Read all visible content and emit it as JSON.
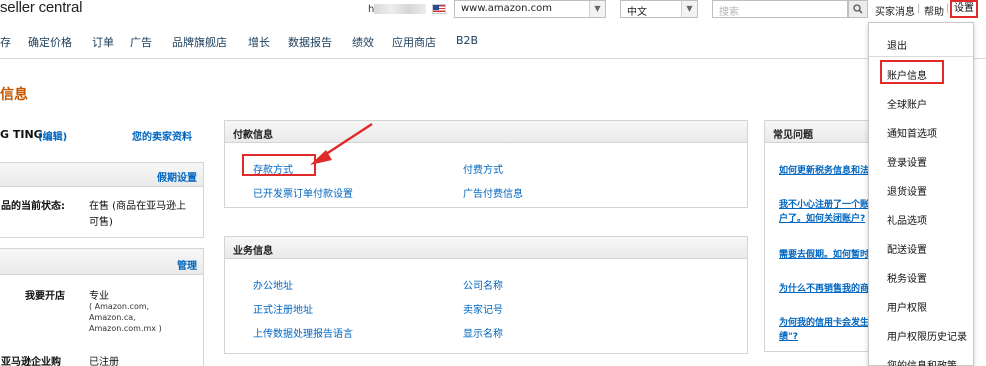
{
  "header": {
    "logo": "seller central",
    "user_initial": "h",
    "marketplace": "www.amazon.com",
    "language": "中文",
    "search_placeholder": "搜索",
    "messages": "买家消息",
    "help": "帮助",
    "settings": "设置"
  },
  "nav": [
    "存",
    "确定价格",
    "订单",
    "广告",
    "品牌旗舰店",
    "增长",
    "数据报告",
    "绩效",
    "应用商店",
    "B2B"
  ],
  "page_title": "信息",
  "left": {
    "name": "G TING",
    "edit": "(编辑)",
    "seller_profile": "您的卖家资料",
    "holiday_settings": "假期设置",
    "status_label": "品的当前状态:",
    "status_value_1": "在售 (商品在亚马逊上",
    "status_value_2": "可售)",
    "manage": "管理",
    "store_label": "我要开店",
    "store_value": "专业",
    "store_markets_1": "( Amazon.com,",
    "store_markets_2": "Amazon.ca,",
    "store_markets_3": "Amazon.com.mx )",
    "biz_label": "亚马逊企业购",
    "biz_value": "已注册"
  },
  "payment": {
    "title": "付款信息",
    "deposit_methods": "存款方式",
    "charge_methods": "付费方式",
    "invoice_settings": "已开发票订单付款设置",
    "ad_payment": "广告付费信息"
  },
  "business": {
    "title": "业务信息",
    "office_address": "办公地址",
    "company_name": "公司名称",
    "registered_address": "正式注册地址",
    "seller_token": "卖家记号",
    "upload_language": "上传数据处理报告语言",
    "display_name": "显示名称"
  },
  "faq": {
    "title": "常见问题",
    "q1": "如何更新税务信息和法定",
    "q2a": "我不小心注册了一个账户",
    "q2b": "户了。如何关闭账户?",
    "q3": "需要去假期。如何暂时停",
    "q4": "为什么不再销售我的商品",
    "q5a": "为何我的信用卡会发生错",
    "q5b": "绩\"?"
  },
  "settings_menu": [
    "退出",
    "账户信息",
    "全球账户",
    "通知首选项",
    "登录设置",
    "退货设置",
    "礼品选项",
    "配送设置",
    "税务设置",
    "用户权限",
    "用户权限历史记录",
    "您的信息和政策"
  ],
  "colors": {
    "highlight": "#e02a2a",
    "link": "#0066c0",
    "title": "#c45500"
  }
}
